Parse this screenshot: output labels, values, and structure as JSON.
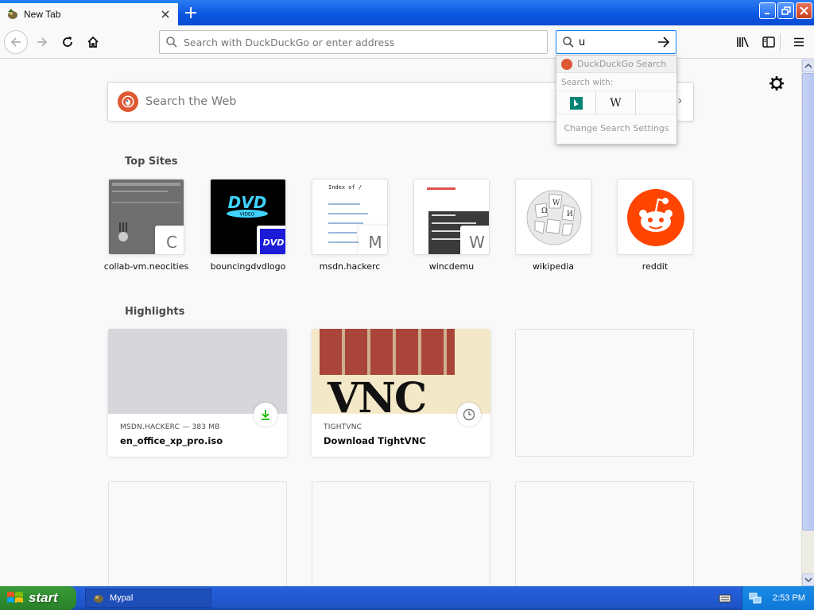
{
  "tab": {
    "title": "New Tab"
  },
  "navbar": {
    "url_placeholder": "Search with DuckDuckGo or enter address",
    "search_value": "u"
  },
  "search_dropdown": {
    "engine_label": "DuckDuckGo Search",
    "search_with_label": "Search with:",
    "engines": [
      "Bing",
      "Wikipedia"
    ],
    "settings_label": "Change Search Settings"
  },
  "page": {
    "web_search_placeholder": "Search the Web",
    "top_sites_title": "Top Sites",
    "highlights_title": "Highlights",
    "top_sites": [
      {
        "label": "collab-vm.neocities",
        "badge": "C"
      },
      {
        "label": "bouncingdvdlogo",
        "badge": ""
      },
      {
        "label": "msdn.hackerc",
        "badge": "M"
      },
      {
        "label": "wincdemu",
        "badge": "W"
      },
      {
        "label": "wikipedia",
        "badge": ""
      },
      {
        "label": "reddit",
        "badge": ""
      }
    ],
    "highlights": [
      {
        "source": "MSDN.HACKERC — 383 MB",
        "title": "en_office_xp_pro.iso",
        "type_icon": "download-icon"
      },
      {
        "source": "TIGHTVNC",
        "title": "Download TightVNC",
        "type_icon": "history-icon"
      }
    ]
  },
  "taskbar": {
    "start_label": "start",
    "window_label": "Mypal",
    "clock": "2:53 PM"
  },
  "colors": {
    "accent": "#0a84ff",
    "xp_blue": "#245edb",
    "ddg_orange": "#de5833",
    "reddit_orange": "#ff4500"
  }
}
